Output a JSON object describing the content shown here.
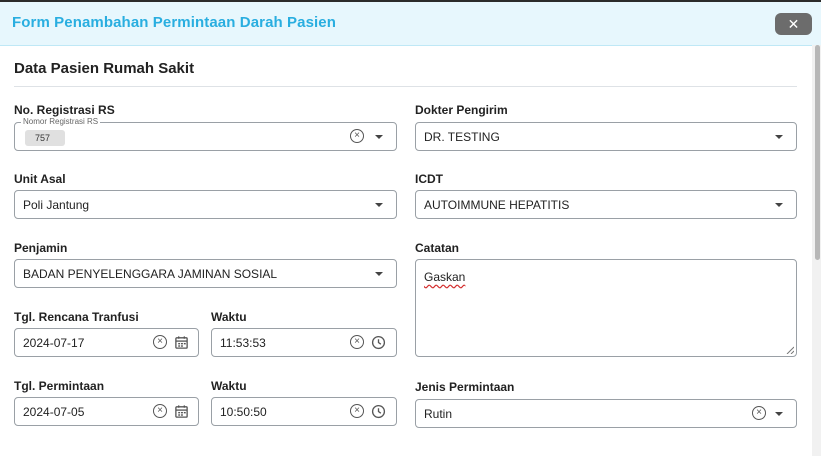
{
  "modal": {
    "title": "Form Penambahan Permintaan Darah Pasien",
    "close_label": "✕"
  },
  "section": {
    "title": "Data Pasien Rumah Sakit"
  },
  "fields": {
    "no_registrasi": {
      "label": "No. Registrasi RS",
      "legend": "Nomor Registrasi RS",
      "chip_value": "757"
    },
    "dokter_pengirim": {
      "label": "Dokter Pengirim",
      "value": "DR. TESTING"
    },
    "unit_asal": {
      "label": "Unit Asal",
      "value": "Poli Jantung"
    },
    "icdt": {
      "label": "ICDT",
      "value": "AUTOIMMUNE HEPATITIS"
    },
    "penjamin": {
      "label": "Penjamin",
      "value": "BADAN PENYELENGGARA JAMINAN SOSIAL"
    },
    "catatan": {
      "label": "Catatan",
      "value": "Gaskan"
    },
    "tgl_rencana_tranfusi": {
      "label": "Tgl. Rencana Tranfusi",
      "value": "2024-07-17"
    },
    "waktu_tranfusi": {
      "label": "Waktu",
      "value": "11:53:53"
    },
    "tgl_permintaan": {
      "label": "Tgl. Permintaan",
      "value": "2024-07-05"
    },
    "waktu_permintaan": {
      "label": "Waktu",
      "value": "10:50:50"
    },
    "jenis_permintaan": {
      "label": "Jenis Permintaan",
      "value": "Rutin"
    }
  },
  "icons": {
    "clear": "circle-x-icon",
    "dropdown": "caret-down-icon",
    "calendar": "calendar-icon",
    "clock": "clock-icon",
    "close": "close-icon"
  },
  "colors": {
    "header_bg": "#e7f7fd",
    "title_color": "#29aee0",
    "close_bg": "#6c6c6c",
    "spellcheck": "#d32f2f"
  }
}
